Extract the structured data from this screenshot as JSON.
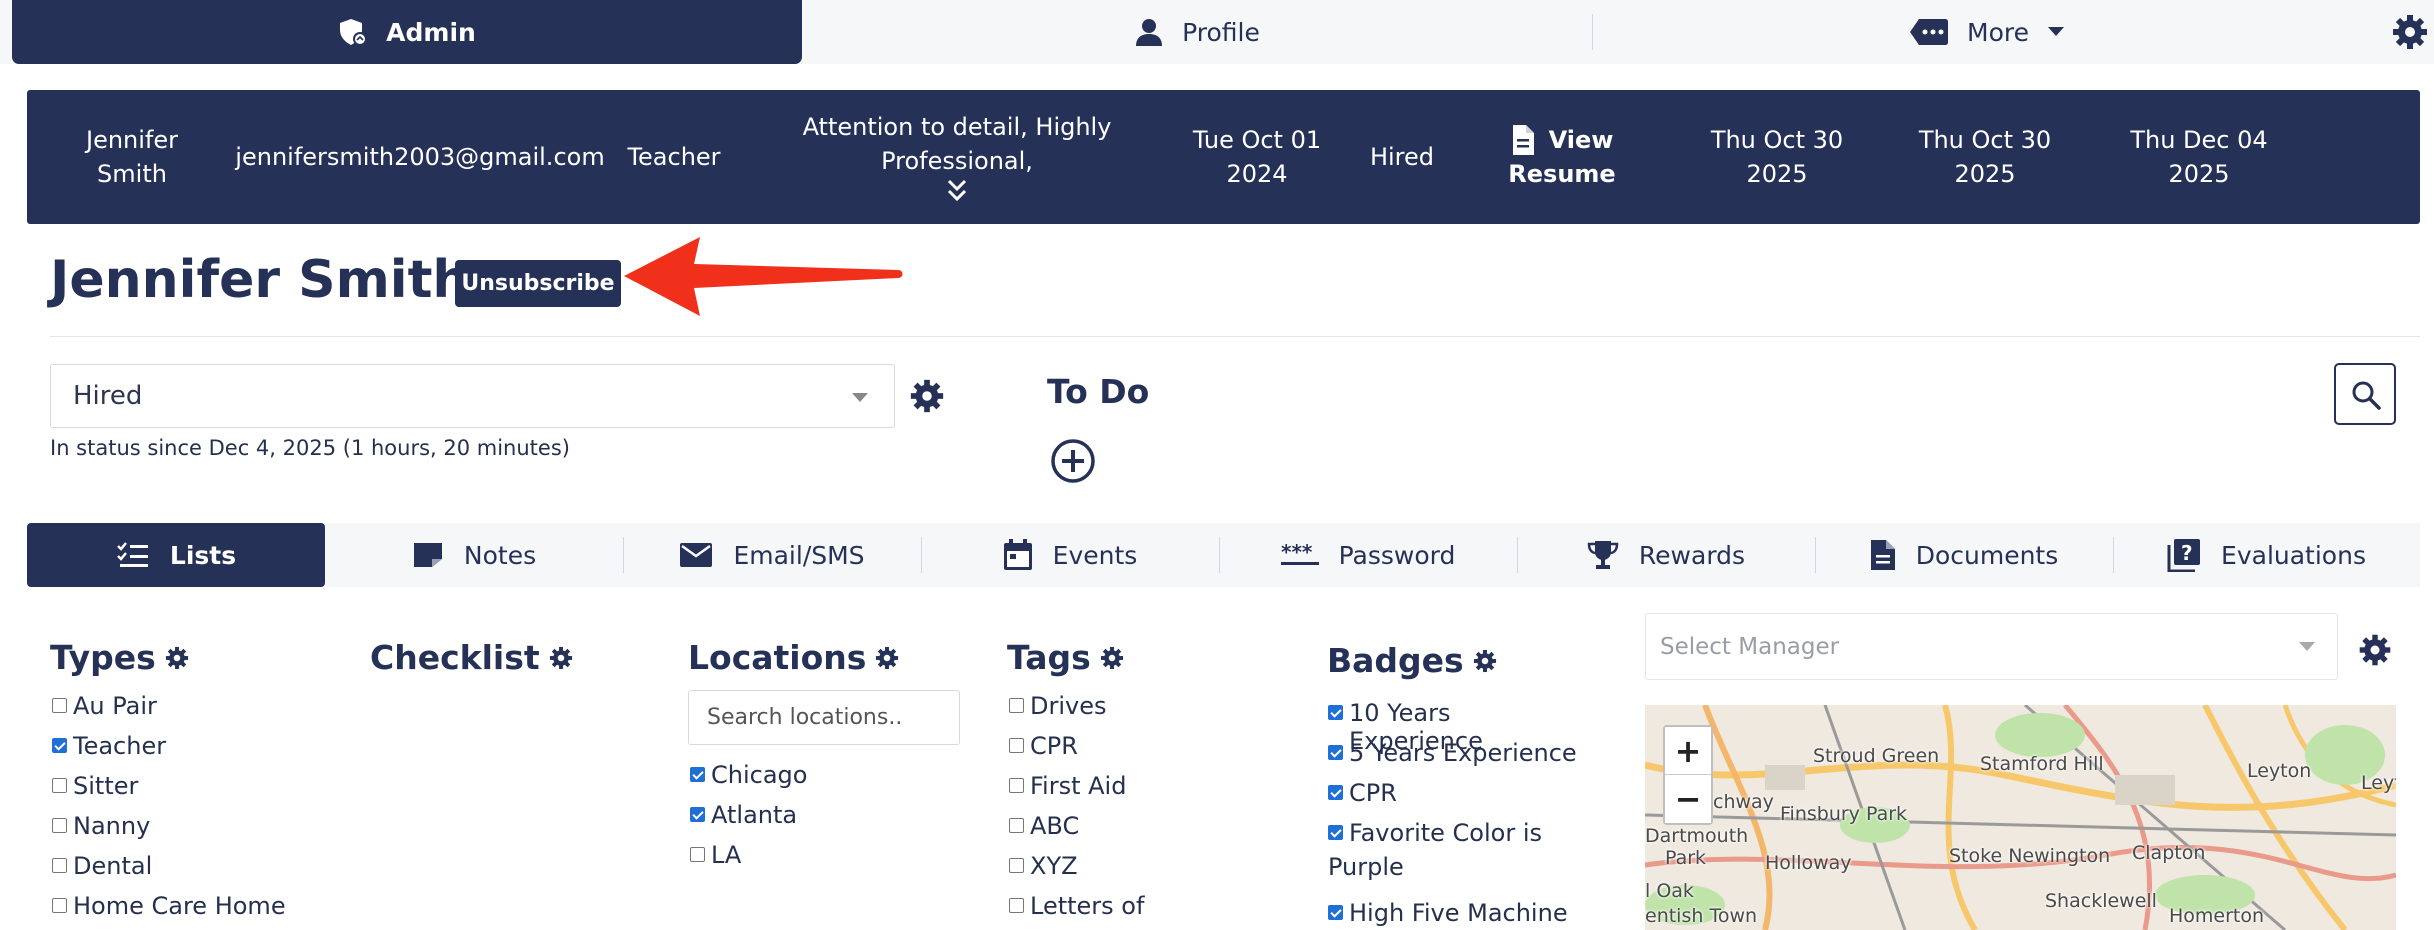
{
  "nav": {
    "admin_label": "Admin",
    "profile_label": "Profile",
    "more_label": "More"
  },
  "summary": {
    "name_line1": "Jennifer",
    "name_line2": "Smith",
    "email": "jennifersmith2003@gmail.com",
    "type": "Teacher",
    "traits_line1": "Attention to detail, Highly",
    "traits_line2": "Professional,",
    "date1_line1": "Tue Oct 01",
    "date1_line2": "2024",
    "status": "Hired",
    "resume_line1": "View",
    "resume_line2": "Resume",
    "date2_line1": "Thu Oct 30",
    "date2_line2": "2025",
    "date3_line1": "Thu Oct 30",
    "date3_line2": "2025",
    "date4_line1": "Thu Dec 04",
    "date4_line2": "2025"
  },
  "header": {
    "title": "Jennifer Smith",
    "unsubscribe_label": "Unsubscribe"
  },
  "status": {
    "selected": "Hired",
    "since": "In status since Dec 4, 2025 (1 hours, 20 minutes)"
  },
  "todo": {
    "title": "To Do"
  },
  "tabs": [
    {
      "label": "Lists",
      "icon": "checklist-icon"
    },
    {
      "label": "Notes",
      "icon": "note-icon"
    },
    {
      "label": "Email/SMS",
      "icon": "envelope-icon"
    },
    {
      "label": "Events",
      "icon": "calendar-icon"
    },
    {
      "label": "Password",
      "icon": "password-icon"
    },
    {
      "label": "Rewards",
      "icon": "trophy-icon"
    },
    {
      "label": "Documents",
      "icon": "document-icon"
    },
    {
      "label": "Evaluations",
      "icon": "question-doc-icon"
    }
  ],
  "types": {
    "title": "Types",
    "items": [
      {
        "label": "Au Pair",
        "checked": false
      },
      {
        "label": "Teacher",
        "checked": true
      },
      {
        "label": "Sitter",
        "checked": false
      },
      {
        "label": "Nanny",
        "checked": false
      },
      {
        "label": "Dental",
        "checked": false
      },
      {
        "label": "Home Care Home",
        "checked": false
      }
    ]
  },
  "checklist": {
    "title": "Checklist"
  },
  "locations": {
    "title": "Locations",
    "search_placeholder": "Search locations..",
    "items": [
      {
        "label": "Chicago",
        "checked": true
      },
      {
        "label": "Atlanta",
        "checked": true
      },
      {
        "label": "LA",
        "checked": false
      }
    ]
  },
  "tags": {
    "title": "Tags",
    "items": [
      {
        "label": "Drives",
        "checked": false
      },
      {
        "label": "CPR",
        "checked": false
      },
      {
        "label": "First Aid",
        "checked": false
      },
      {
        "label": "ABC",
        "checked": false
      },
      {
        "label": "XYZ",
        "checked": false
      },
      {
        "label": "Letters of",
        "checked": false
      }
    ]
  },
  "badges": {
    "title": "Badges",
    "items": [
      {
        "label": "10 Years Experience",
        "checked": true
      },
      {
        "label": "5 Years Experience",
        "checked": true
      },
      {
        "label": "CPR",
        "checked": true
      },
      {
        "label": "Favorite Color is",
        "label2": "Purple",
        "checked": true
      },
      {
        "label": "High Five Machine",
        "checked": true
      }
    ]
  },
  "manager": {
    "placeholder": "Select Manager"
  },
  "map": {
    "zoom_in": "+",
    "zoom_out": "−",
    "labels": {
      "stroud_green": "Stroud Green",
      "stamford_hill": "Stamford Hill",
      "leyton": "Leyton",
      "leyton_cut": "Leyt",
      "chway": "chway",
      "finsbury_park": "Finsbury Park",
      "dartmouth": "Dartmouth",
      "park": "Park",
      "holloway": "Holloway",
      "stoke_newington": "Stoke Newington",
      "clapton": "Clapton",
      "oak": "l Oak",
      "shacklewell": "Shacklewell",
      "entish_town": "entish Town",
      "homerton": "Homerton"
    }
  },
  "colors": {
    "navy": "#263158",
    "annotation_red": "#f0301a",
    "checkbox_blue": "#1f6fd6"
  }
}
